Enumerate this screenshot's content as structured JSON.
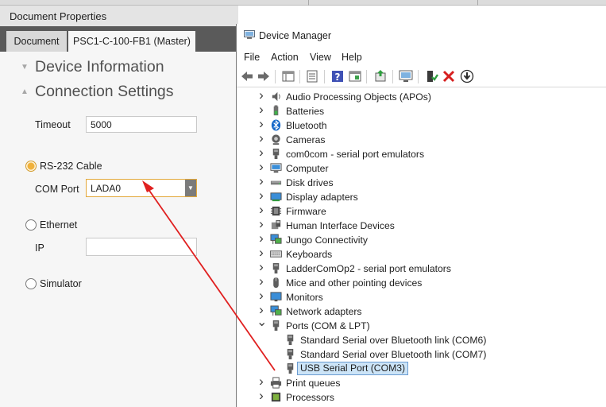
{
  "colors": {
    "accent_orange": "#f0b13b",
    "arrow_red": "#e02020",
    "selection_blue": "#cce4f7",
    "tab_bar": "#5a5a5a"
  },
  "document_properties": {
    "title": "Document Properties",
    "tabs": [
      {
        "label": "Document"
      },
      {
        "label": "PSC1-C-100-FB1 (Master)",
        "active": true
      }
    ],
    "sections": {
      "device_information": "Device Information",
      "connection_settings": "Connection Settings"
    },
    "timeout": {
      "label": "Timeout",
      "value": "5000"
    },
    "rs232": {
      "label": "RS-232 Cable",
      "selected": true
    },
    "com_port": {
      "label": "COM Port",
      "value": "LADA0"
    },
    "ethernet": {
      "label": "Ethernet",
      "selected": false
    },
    "ip": {
      "label": "IP",
      "value": ""
    },
    "simulator": {
      "label": "Simulator",
      "selected": false
    }
  },
  "device_manager": {
    "title": "Device Manager",
    "menu": [
      "File",
      "Action",
      "View",
      "Help"
    ],
    "toolbar_icons": [
      "back-icon",
      "forward-icon",
      "properties-grid-icon",
      "driver-icon",
      "help-icon",
      "view-icon",
      "update-driver-icon",
      "monitor-scan-icon",
      "enable-device-icon",
      "uninstall-icon",
      "download-icon"
    ],
    "tree": [
      {
        "label": "Audio Processing Objects (APOs)",
        "icon": "speaker-icon",
        "expanded": false,
        "level": 0
      },
      {
        "label": "Batteries",
        "icon": "battery-icon",
        "expanded": false,
        "level": 0
      },
      {
        "label": "Bluetooth",
        "icon": "bluetooth-icon",
        "expanded": false,
        "level": 0
      },
      {
        "label": "Cameras",
        "icon": "camera-icon",
        "expanded": false,
        "level": 0
      },
      {
        "label": "com0com - serial port emulators",
        "icon": "port-icon",
        "expanded": false,
        "level": 0
      },
      {
        "label": "Computer",
        "icon": "computer-icon",
        "expanded": false,
        "level": 0
      },
      {
        "label": "Disk drives",
        "icon": "disk-icon",
        "expanded": false,
        "level": 0
      },
      {
        "label": "Display adapters",
        "icon": "display-adapter-icon",
        "expanded": false,
        "level": 0
      },
      {
        "label": "Firmware",
        "icon": "firmware-icon",
        "expanded": false,
        "level": 0
      },
      {
        "label": "Human Interface Devices",
        "icon": "hid-icon",
        "expanded": false,
        "level": 0
      },
      {
        "label": "Jungo Connectivity",
        "icon": "network-icon",
        "expanded": false,
        "level": 0
      },
      {
        "label": "Keyboards",
        "icon": "keyboard-icon",
        "expanded": false,
        "level": 0
      },
      {
        "label": "LadderComOp2 - serial port emulators",
        "icon": "port-icon",
        "expanded": false,
        "level": 0
      },
      {
        "label": "Mice and other pointing devices",
        "icon": "mouse-icon",
        "expanded": false,
        "level": 0
      },
      {
        "label": "Monitors",
        "icon": "monitor-icon",
        "expanded": false,
        "level": 0
      },
      {
        "label": "Network adapters",
        "icon": "network-icon",
        "expanded": false,
        "level": 0
      },
      {
        "label": "Ports (COM & LPT)",
        "icon": "port-icon",
        "expanded": true,
        "level": 0
      },
      {
        "label": "Standard Serial over Bluetooth link (COM6)",
        "icon": "port-icon",
        "level": 1
      },
      {
        "label": "Standard Serial over Bluetooth link (COM7)",
        "icon": "port-icon",
        "level": 1
      },
      {
        "label": "USB Serial Port (COM3)",
        "icon": "port-icon",
        "level": 1,
        "selected": true
      },
      {
        "label": "Print queues",
        "icon": "printer-icon",
        "expanded": false,
        "level": 0
      },
      {
        "label": "Processors",
        "icon": "processor-icon",
        "expanded": false,
        "level": 0
      }
    ]
  }
}
